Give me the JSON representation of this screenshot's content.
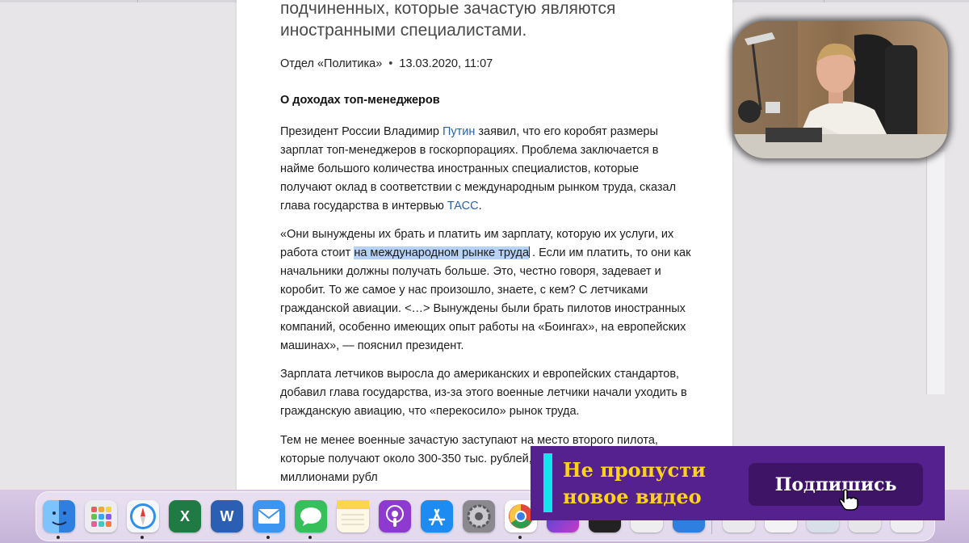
{
  "article": {
    "lead": "топ-менеджеры не могут получать меньше своих подчиненных, которые зачастую являются иностранными специалистами.",
    "department": "Отдел «Политика»",
    "date": "13.03.2020, 11:07",
    "subheading": "О доходах топ-менеджеров",
    "p1_a": "Президент России Владимир ",
    "p1_link": "Путин",
    "p1_b": " заявил, что его коробят размеры зарплат топ-менеджеров в госкорпорациях. Проблема заключается в найме большого количества иностранных специалистов, которые получают оклад в соответствии с международным рынком труда, сказал глава государства в интервью ",
    "p1_link2": "ТАСС",
    "p1_c": ".",
    "p2_a": "«Они вынуждены их брать и платить им зарплату, которую их услуги, их работа стоит ",
    "p2_highlight": "на международном рынке труда",
    "p2_b": ". Если им платить, то они как начальники должны получать больше. Это, честно говоря, задевает и коробит. То же самое у нас произошло, знаете, с кем? С летчиками гражданской авиации. <…> Вынуждены были брать пилотов иностранных компаний, особенно имеющих опыт работы на «Боингах», на европейских машинах», — пояснил президент.",
    "p3": "Зарплата летчиков выросла до американских и европейских стандартов, добавил глава государства, из-за этого военные летчики начали уходить в гражданскую авиацию, что «перекосило» рынок труда.",
    "p4": "Тем не менее военные зачастую заступают на место второго пилота, которые получают около 300-350 тыс. рублей, менеджеров же исчисляется миллионами рубл"
  },
  "banner": {
    "line1": "Не пропусти",
    "line2": "новое видео",
    "button": "Подпишись"
  },
  "dock": {
    "items": [
      {
        "name": "finder-icon",
        "color": "#3b8fe8"
      },
      {
        "name": "launchpad-icon",
        "color": "#e9e9ee"
      },
      {
        "name": "safari-icon",
        "color": "#f4f6f9"
      },
      {
        "name": "excel-icon",
        "color": "#1f7a44",
        "glyph": "X"
      },
      {
        "name": "word-icon",
        "color": "#2b5fb3",
        "glyph": "W"
      },
      {
        "name": "mail-icon",
        "color": "#3c95f0"
      },
      {
        "name": "messages-icon",
        "color": "#36c05a"
      },
      {
        "name": "notes-icon",
        "color": "#fbd64a"
      },
      {
        "name": "podcasts-icon",
        "color": "#8e3ad1"
      },
      {
        "name": "app-store-icon",
        "color": "#1c8cf3"
      },
      {
        "name": "system-preferences-icon",
        "color": "#8a8a8e"
      },
      {
        "name": "chrome-icon",
        "color": "#ffffff"
      }
    ]
  }
}
